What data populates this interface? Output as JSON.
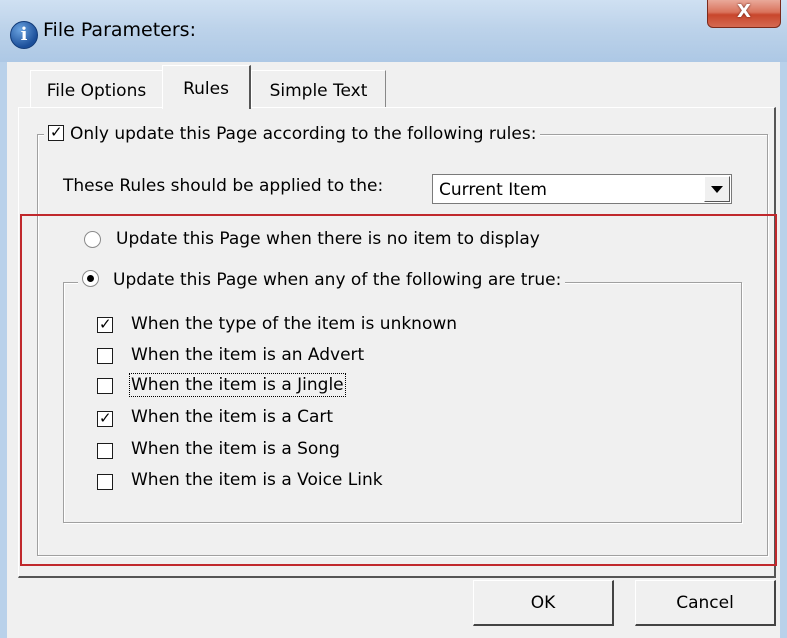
{
  "window": {
    "title": "File Parameters:",
    "close_label": "X"
  },
  "tabs": [
    {
      "label": "File Options",
      "active": false
    },
    {
      "label": "Rules",
      "active": true
    },
    {
      "label": "Simple Text",
      "active": false
    }
  ],
  "rules": {
    "only_update_label": "Only update this Page according to the following rules:",
    "only_update_checked": true,
    "applied_to_label": "These Rules should be applied to the:",
    "applied_to_value": "Current Item",
    "radio_no_item_label": "Update this Page when there is no item to display",
    "radio_no_item_selected": false,
    "radio_any_true_label": "Update this Page when any of the following are true:",
    "radio_any_true_selected": true,
    "conditions": [
      {
        "label": "When the type of the item is unknown",
        "checked": true
      },
      {
        "label": "When the item is an Advert",
        "checked": false
      },
      {
        "label": "When the item is a Jingle",
        "checked": false
      },
      {
        "label": "When the item is a Cart",
        "checked": true
      },
      {
        "label": "When the item is a Song",
        "checked": false
      },
      {
        "label": "When the item is a Voice Link",
        "checked": false
      }
    ]
  },
  "buttons": {
    "ok": "OK",
    "cancel": "Cancel"
  },
  "colors": {
    "highlight_border": "#c0282c",
    "title_bar": "#bdd3ea"
  },
  "check_glyph": "✓"
}
